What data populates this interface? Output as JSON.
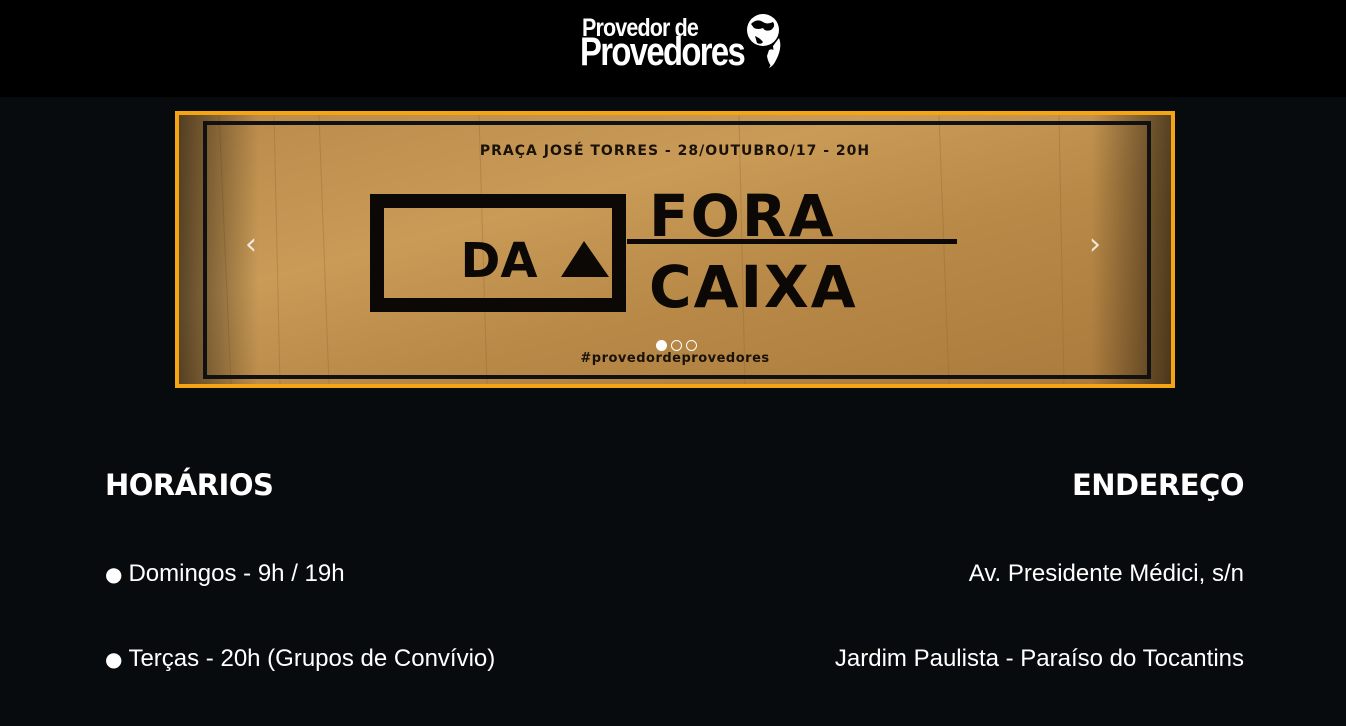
{
  "header": {
    "logo_line1": "Provedor de",
    "logo_line2": "Provedores"
  },
  "carousel": {
    "slide_top_text": "PRAÇA JOSÉ TORRES - 28/OUTUBRO/17 - 20H",
    "slide_word_da": "DA",
    "slide_word_fora": "FORA",
    "slide_word_caixa": "CAIXA",
    "slide_hashtag": "#provedordeprovedores",
    "prev_arrow": "‹",
    "next_arrow": "›",
    "slide_count": 3,
    "active_slide": 1,
    "border_color": "#f5a414"
  },
  "horarios": {
    "title": "HORÁRIOS",
    "bullet": "●",
    "items": [
      "Domingos - 9h / 19h",
      "Terças - 20h (Grupos de Convívio)"
    ]
  },
  "endereco": {
    "title": "ENDEREÇO",
    "lines": [
      "Av. Presidente Médici, s/n",
      "Jardim Paulista - Paraíso do Tocantins"
    ]
  }
}
